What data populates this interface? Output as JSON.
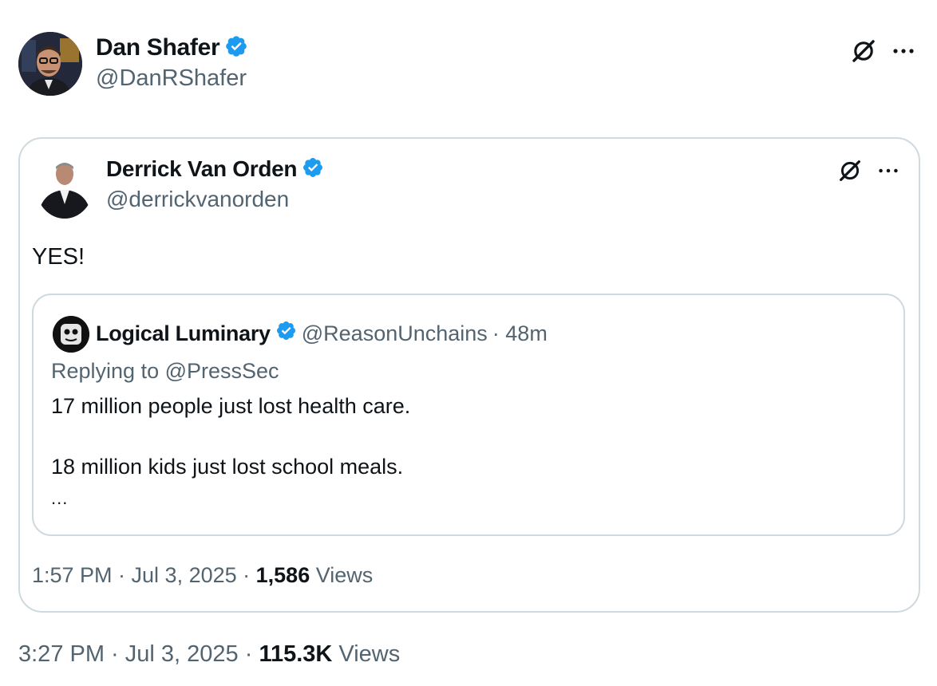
{
  "outer_tweet": {
    "author_name": "Dan Shafer",
    "author_handle": "@DanRShafer",
    "timestamp": "3:27 PM · Jul 3, 2025 · ",
    "views_count": "115.3K",
    "views_label": " Views"
  },
  "quoted_tweet": {
    "author_name": "Derrick Van Orden",
    "author_handle": "@derrickvanorden",
    "text": "YES!",
    "timestamp": "1:57 PM · Jul 3, 2025 · ",
    "views_count": "1,586",
    "views_label": " Views"
  },
  "nested_quote": {
    "author_name": "Logical Luminary",
    "author_handle": "@ReasonUnchains",
    "time_ago": "· 48m",
    "replying_to": "Replying to @PressSec",
    "line1": "17 million people just lost health care.",
    "line2": "18 million kids just lost school meals.",
    "ellipsis": "..."
  },
  "icons": {
    "verified": "verified-badge-icon",
    "grok": "grok-icon",
    "more": "more-options-icon"
  },
  "colors": {
    "verified_blue": "#1d9bf0",
    "secondary_text": "#536471",
    "primary_text": "#0f1419",
    "border": "#cfd9de"
  }
}
